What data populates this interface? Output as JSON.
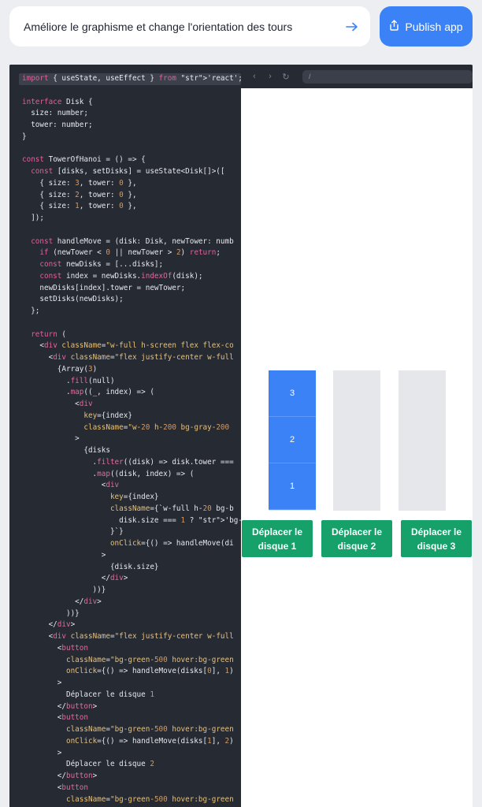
{
  "prompt": {
    "text_before": "Améliore le graphisme et change l'orientation des ",
    "text_underlined": "tours"
  },
  "publish_label": "Publish app",
  "browser": {
    "url": "/"
  },
  "code_lines": [
    "import { useState, useEffect } from 'react';",
    "",
    "interface Disk {",
    "  size: number;",
    "  tower: number;",
    "}",
    "",
    "const TowerOfHanoi = () => {",
    "  const [disks, setDisks] = useState<Disk[]>([",
    "    { size: 3, tower: 0 },",
    "    { size: 2, tower: 0 },",
    "    { size: 1, tower: 0 },",
    "  ]);",
    "",
    "  const handleMove = (disk: Disk, newTower: numb",
    "    if (newTower < 0 || newTower > 2) return;",
    "    const newDisks = [...disks];",
    "    const index = newDisks.indexOf(disk);",
    "    newDisks[index].tower = newTower;",
    "    setDisks(newDisks);",
    "  };",
    "",
    "  return (",
    "    <div className=\"w-full h-screen flex flex-co",
    "      <div className=\"flex justify-center w-full",
    "        {Array(3)",
    "          .fill(null)",
    "          .map((_, index) => (",
    "            <div",
    "              key={index}",
    "              className=\"w-20 h-200 bg-gray-200",
    "            >",
    "              {disks",
    "                .filter((disk) => disk.tower ===",
    "                .map((disk, index) => (",
    "                  <div",
    "                    key={index}",
    "                    className={`w-full h-20 bg-b",
    "                      disk.size === 1 ? 'bg-red-",
    "                    }`}",
    "                    onClick={() => handleMove(di",
    "                  >",
    "                    {disk.size}",
    "                  </div>",
    "                ))}",
    "            </div>",
    "          ))}",
    "      </div>",
    "      <div className=\"flex justify-center w-full",
    "        <button",
    "          className=\"bg-green-500 hover:bg-green",
    "          onClick={() => handleMove(disks[0], 1)",
    "        >",
    "          Déplacer le disque 1",
    "        </button>",
    "        <button",
    "          className=\"bg-green-500 hover:bg-green",
    "          onClick={() => handleMove(disks[1], 2)",
    "        >",
    "          Déplacer le disque 2",
    "        </button>",
    "        <button",
    "          className=\"bg-green-500 hover:bg-green"
  ],
  "disks": [
    "3",
    "2",
    "1"
  ],
  "buttons": [
    {
      "line1": "Déplacer le",
      "line2": "disque 1"
    },
    {
      "line1": "Déplacer le",
      "line2": "disque 2"
    },
    {
      "line1": "Déplacer le",
      "line2": "disque 3"
    }
  ],
  "colors": {
    "accent": "#3b82f6",
    "tower": "#e5e7eb",
    "button": "#16a06a",
    "editor_bg": "#262a33"
  }
}
